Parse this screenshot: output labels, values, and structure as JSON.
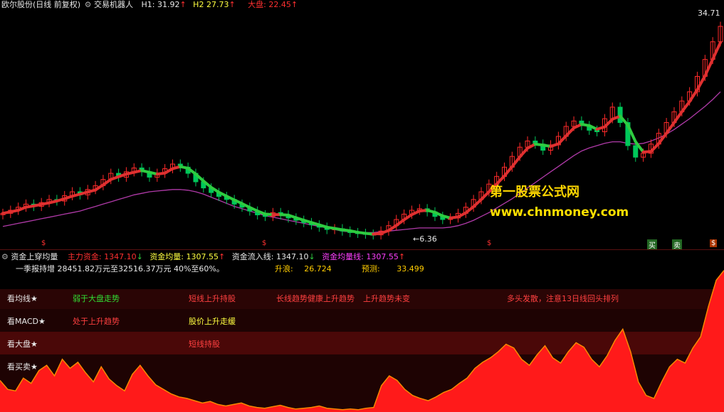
{
  "colors": {
    "bg": "#000000",
    "up": "#ff2a2a",
    "down": "#00c85a",
    "ma_up": "#e03030",
    "ma_down": "#2ecc40",
    "envelope": "#b03aa8",
    "area": "#ff1a1a",
    "area_line": "#ff8800",
    "band1": "#2a0505",
    "band2": "#1e0303",
    "band3": "#4a0808",
    "title": "#e8e8e8",
    "watermark1": "#ffd700",
    "watermark2": "#ffe000"
  },
  "header": {
    "title": "欧尔股份(日线 前复权)",
    "indicator": "交易机器人",
    "h1_label": "H1:",
    "h1_value": "31.92",
    "h2_label": "H2",
    "h2_value": "27.73",
    "market_label": "大盘:",
    "market_value": "22.45",
    "arrow_up": "↑"
  },
  "price_labels": {
    "high": "34.71",
    "low": "6.36",
    "low_arrow": "←"
  },
  "markers": {
    "s": "$",
    "b1": "买",
    "b2": "卖",
    "b3": "$"
  },
  "indicator_bar": {
    "title": "资金上穿均量",
    "items": [
      {
        "label": "主力资金:",
        "value": "1347.10",
        "arrow": "↓",
        "color": "#ff3030"
      },
      {
        "label": "资金均量:",
        "value": "1307.55",
        "arrow": "↑",
        "color": "#ffff00"
      },
      {
        "label": "资金流入线:",
        "value": "1347.10",
        "arrow": "↓",
        "color": "#ffffff"
      },
      {
        "label": "资金均量线:",
        "value": "1307.55",
        "arrow": "↑",
        "color": "#ff40ff"
      }
    ]
  },
  "info_line": {
    "text": "一季报持增 28451.82万元至32516.37万元 40%至60%。",
    "rise_label": "升浪:",
    "rise_value": "26.724",
    "predict_label": "预测:",
    "predict_value": "33.499"
  },
  "rows": [
    {
      "label": "看均线★",
      "cells": [
        {
          "text": "弱于大盘走势",
          "color": "#33dd33"
        },
        {
          "text": "短线上升持股",
          "color": "#ff4040"
        },
        {
          "text": "长线趋势健康上升趋势",
          "color": "#ff4040"
        },
        {
          "text": "上升趋势未变",
          "color": "#ff4040"
        },
        {
          "text": "多头发散，注意13日线回头排列",
          "color": "#ff4040"
        }
      ]
    },
    {
      "label": "看MACD★",
      "cells": [
        {
          "text": "处于上升趋势",
          "color": "#ff4040"
        },
        {
          "text": "股价上升走缓",
          "color": "#ffff40"
        }
      ]
    },
    {
      "label": "看大盘★",
      "cells": [
        {
          "text": "短线持股",
          "color": "#ff4040"
        }
      ]
    },
    {
      "label": "看买卖★",
      "cells": []
    }
  ],
  "watermark": {
    "line1": "第一股票公式网",
    "line2": "www.chnmoney.com"
  },
  "chart_data": {
    "type": "line",
    "main_series_name": "",
    "price_ylim": [
      6,
      36
    ],
    "close": [
      9.2,
      9.6,
      10.0,
      10.4,
      10.1,
      10.6,
      11.0,
      10.8,
      11.5,
      12.0,
      11.6,
      12.3,
      12.8,
      13.6,
      14.4,
      13.9,
      14.6,
      15.1,
      14.6,
      13.9,
      14.4,
      15.0,
      15.6,
      15.2,
      14.4,
      13.3,
      12.5,
      11.9,
      11.4,
      11.0,
      10.4,
      10.0,
      9.5,
      9.0,
      8.8,
      9.3,
      9.0,
      8.6,
      8.3,
      8.0,
      7.7,
      7.4,
      7.1,
      7.2,
      6.9,
      6.7,
      6.6,
      6.5,
      6.4,
      6.9,
      7.6,
      8.4,
      9.1,
      9.6,
      9.8,
      9.4,
      8.8,
      8.4,
      8.6,
      9.2,
      10.0,
      11.0,
      12.0,
      13.0,
      14.0,
      15.2,
      16.6,
      17.8,
      18.6,
      18.2,
      17.4,
      18.1,
      19.2,
      20.5,
      21.2,
      20.6,
      20.0,
      19.8,
      21.5,
      23.0,
      21.0,
      18.0,
      16.5,
      17.0,
      18.2,
      19.6,
      21.0,
      22.4,
      23.8,
      25.0,
      27.0,
      29.2,
      31.5,
      33.5
    ],
    "envelope": [
      7.5,
      7.7,
      7.9,
      8.1,
      8.3,
      8.5,
      8.7,
      8.9,
      9.1,
      9.3,
      9.5,
      9.8,
      10.1,
      10.4,
      10.7,
      11.0,
      11.3,
      11.6,
      11.8,
      12.0,
      12.1,
      12.2,
      12.3,
      12.3,
      12.2,
      12.0,
      11.7,
      11.3,
      10.9,
      10.5,
      10.1,
      9.8,
      9.5,
      9.2,
      8.9,
      8.7,
      8.5,
      8.3,
      8.1,
      7.9,
      7.7,
      7.5,
      7.3,
      7.1,
      6.9,
      6.8,
      6.7,
      6.7,
      6.7,
      6.8,
      6.9,
      7.0,
      7.1,
      7.2,
      7.3,
      7.3,
      7.3,
      7.3,
      7.4,
      7.6,
      7.9,
      8.3,
      8.8,
      9.3,
      9.9,
      10.5,
      11.1,
      11.8,
      12.5,
      13.2,
      13.9,
      14.6,
      15.3,
      16.0,
      16.7,
      17.3,
      17.7,
      18.0,
      18.3,
      18.5,
      18.5,
      18.3,
      18.2,
      18.3,
      18.6,
      19.0,
      19.5,
      20.1,
      20.8,
      21.5,
      22.3,
      23.1,
      24.0,
      25.0
    ],
    "area_values": [
      42,
      30,
      28,
      45,
      38,
      55,
      62,
      48,
      70,
      58,
      66,
      52,
      40,
      60,
      44,
      35,
      28,
      50,
      62,
      48,
      36,
      30,
      24,
      20,
      18,
      15,
      12,
      14,
      10,
      8,
      10,
      12,
      8,
      6,
      5,
      7,
      9,
      6,
      4,
      5,
      6,
      8,
      5,
      4,
      3,
      4,
      3,
      5,
      6,
      35,
      48,
      42,
      30,
      22,
      18,
      15,
      20,
      26,
      30,
      38,
      45,
      58,
      66,
      72,
      80,
      90,
      85,
      70,
      62,
      76,
      88,
      72,
      65,
      80,
      92,
      86,
      70,
      60,
      75,
      95,
      110,
      80,
      40,
      22,
      18,
      40,
      60,
      70,
      65,
      85,
      100,
      140,
      175,
      188
    ]
  }
}
